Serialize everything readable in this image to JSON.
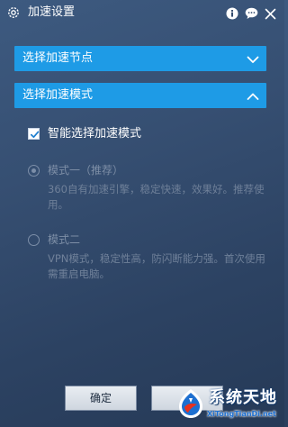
{
  "window": {
    "title": "加速设置",
    "icons": [
      "gear-icon",
      "info-icon",
      "chat-icon",
      "close-icon"
    ]
  },
  "sections": {
    "nodes": {
      "label": "选择加速节点",
      "expanded": false
    },
    "mode": {
      "label": "选择加速模式",
      "expanded": true
    }
  },
  "smart_mode": {
    "label": "智能选择加速模式",
    "checked": true
  },
  "options": [
    {
      "title": "模式一（推荐）",
      "desc": "360自有加速引擎，稳定快速，效果好。推荐使用。",
      "selected": true,
      "disabled": true
    },
    {
      "title": "模式二",
      "desc": "VPN模式，稳定性高，防闪断能力强。首次使用需重启电脑。",
      "selected": false,
      "disabled": true
    }
  ],
  "buttons": {
    "confirm": "确定",
    "cancel": ""
  },
  "watermark": {
    "title": "系统天地",
    "url": "XiTongTianDi.net"
  },
  "colors": {
    "accent": "#1e9be6",
    "background": "#334b6e",
    "disabled_text": "#7d8ea6"
  }
}
